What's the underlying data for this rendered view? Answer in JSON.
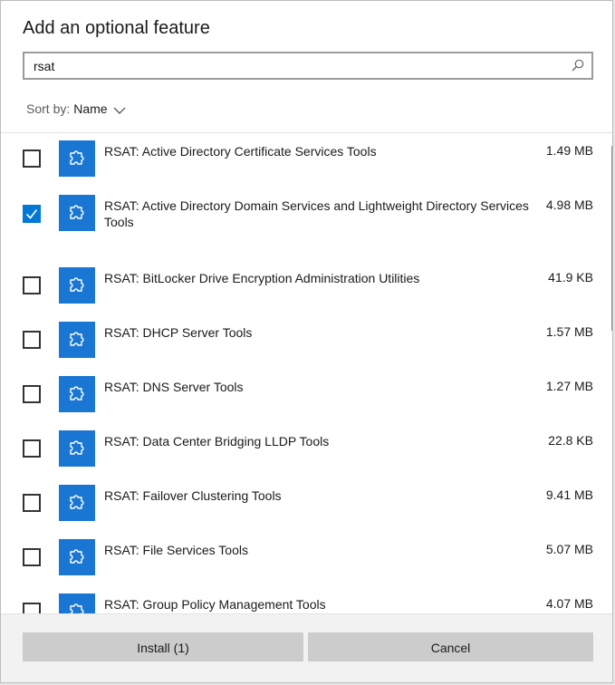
{
  "dialog": {
    "title": "Add an optional feature"
  },
  "search": {
    "value": "rsat",
    "icon": "search-icon"
  },
  "sort": {
    "label": "Sort by:",
    "value": "Name"
  },
  "colors": {
    "accent": "#0078d7",
    "tile": "#1976d2"
  },
  "features": [
    {
      "name": "RSAT: Active Directory Certificate Services Tools",
      "size": "1.49 MB",
      "checked": false
    },
    {
      "name": "RSAT: Active Directory Domain Services and Lightweight Directory Services Tools",
      "size": "4.98 MB",
      "checked": true
    },
    {
      "name": "RSAT: BitLocker Drive Encryption Administration Utilities",
      "size": "41.9 KB",
      "checked": false
    },
    {
      "name": "RSAT: DHCP Server Tools",
      "size": "1.57 MB",
      "checked": false
    },
    {
      "name": "RSAT: DNS Server Tools",
      "size": "1.27 MB",
      "checked": false
    },
    {
      "name": "RSAT: Data Center Bridging LLDP Tools",
      "size": "22.8 KB",
      "checked": false
    },
    {
      "name": "RSAT: Failover Clustering Tools",
      "size": "9.41 MB",
      "checked": false
    },
    {
      "name": "RSAT: File Services Tools",
      "size": "5.07 MB",
      "checked": false
    },
    {
      "name": "RSAT: Group Policy Management Tools",
      "size": "4.07 MB",
      "checked": false
    }
  ],
  "footer": {
    "install_label": "Install (1)",
    "cancel_label": "Cancel"
  }
}
